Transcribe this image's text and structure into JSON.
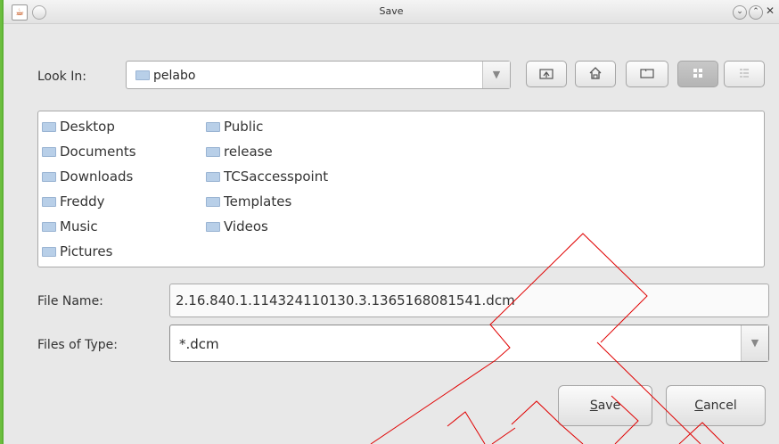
{
  "window": {
    "title": "Save"
  },
  "lookin": {
    "label": "Look In:",
    "value": "pelabo"
  },
  "folders_col1": [
    "Desktop",
    "Documents",
    "Downloads",
    "Freddy",
    "Music",
    "Pictures"
  ],
  "folders_col2": [
    "Public",
    "release",
    "TCSaccesspoint",
    "Templates",
    "Videos"
  ],
  "filename": {
    "label": "File Name:",
    "value": "2.16.840.1.114324110130.3.1365168081541.dcm"
  },
  "filetype": {
    "label": "Files of Type:",
    "value": "*.dcm"
  },
  "buttons": {
    "save_first": "S",
    "save_rest": "ave",
    "cancel_first": "C",
    "cancel_rest": "ancel"
  },
  "icons": {
    "app": "java-cup-icon",
    "up": "up-folder-icon",
    "home": "home-icon",
    "newfolder": "new-folder-icon",
    "list": "list-view-icon",
    "details": "details-view-icon"
  },
  "colors": {
    "desktop_bg": "#6cbf3f",
    "folder": "#b8cfe8",
    "annotation": "#e00000"
  }
}
